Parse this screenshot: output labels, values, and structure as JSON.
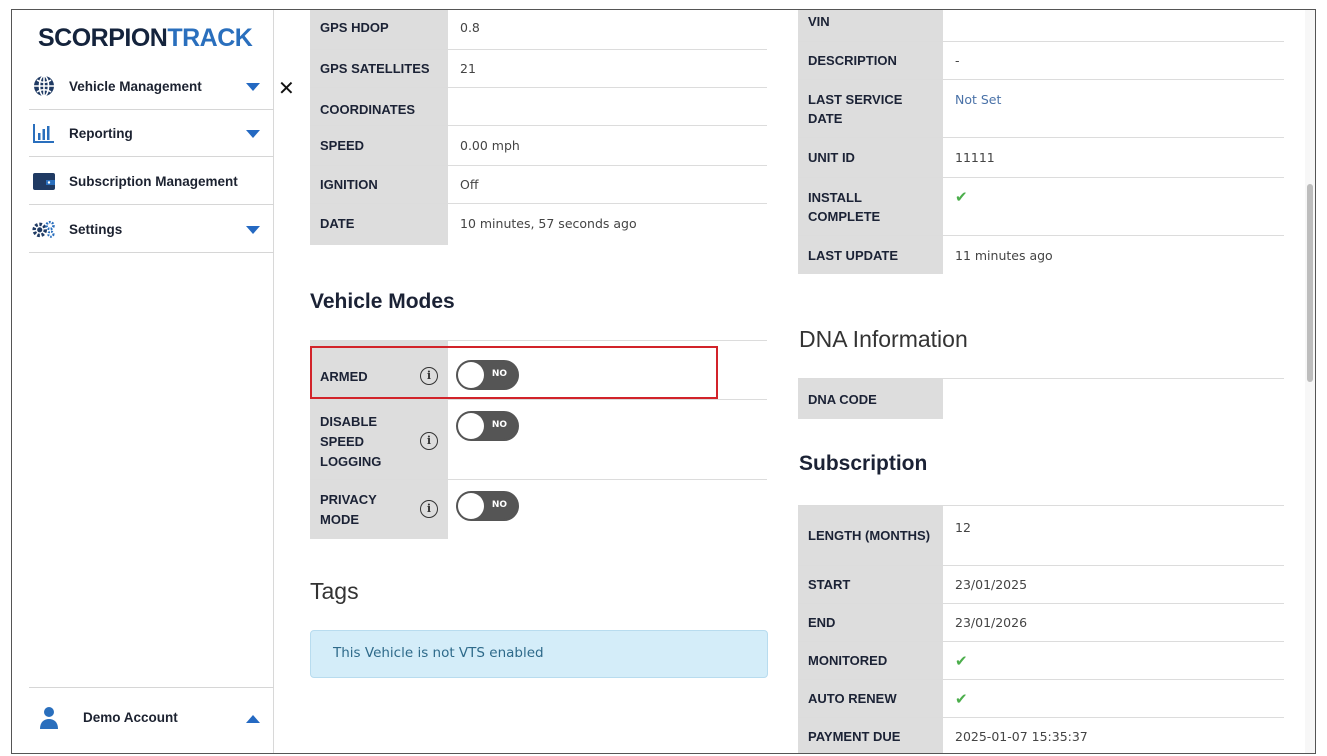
{
  "logo": {
    "part1": "SCORPION",
    "part2": "TRACK"
  },
  "sidebar": {
    "items": [
      {
        "label": "Vehicle Management",
        "icon": "globe-icon",
        "caret": "down"
      },
      {
        "label": "Reporting",
        "icon": "bar-chart-icon",
        "caret": "down"
      },
      {
        "label": "Subscription Management",
        "icon": "wallet-icon"
      },
      {
        "label": "Settings",
        "icon": "gears-icon",
        "caret": "down"
      }
    ],
    "account_label": "Demo Account"
  },
  "close_label": "✕",
  "gps": {
    "rows": [
      {
        "key": "GPS HDOP",
        "value": "0.8"
      },
      {
        "key": "GPS SATELLITES",
        "value": "21"
      },
      {
        "key": "COORDINATES",
        "value": ""
      },
      {
        "key": "SPEED",
        "value": "0.00 mph"
      },
      {
        "key": "IGNITION",
        "value": "Off"
      },
      {
        "key": "DATE",
        "value": "10 minutes, 57 seconds ago"
      }
    ]
  },
  "modes": {
    "title": "Vehicle Modes",
    "rows": [
      {
        "label": "ARMED",
        "state": "NO"
      },
      {
        "label": "DISABLE SPEED LOGGING",
        "state": "NO"
      },
      {
        "label": "PRIVACY MODE",
        "state": "NO"
      }
    ]
  },
  "tags": {
    "title": "Tags",
    "alert": "This Vehicle is not VTS enabled"
  },
  "vehicle_info": {
    "rows": [
      {
        "key": "VIN",
        "value": ""
      },
      {
        "key": "DESCRIPTION",
        "value": "-"
      },
      {
        "key": "LAST SERVICE DATE",
        "value": "Not Set"
      },
      {
        "key": "UNIT ID",
        "value": "11111"
      },
      {
        "key": "INSTALL COMPLETE",
        "value": "✔"
      },
      {
        "key": "LAST UPDATE",
        "value": "11 minutes ago"
      }
    ]
  },
  "dna": {
    "title": "DNA Information",
    "rows": [
      {
        "key": "DNA CODE",
        "value": ""
      }
    ]
  },
  "subscription": {
    "title": "Subscription",
    "rows": [
      {
        "key": "LENGTH (MONTHS)",
        "value": "12"
      },
      {
        "key": "START",
        "value": "23/01/2025"
      },
      {
        "key": "END",
        "value": "23/01/2026"
      },
      {
        "key": "MONITORED",
        "value": "✔"
      },
      {
        "key": "AUTO RENEW",
        "value": "✔"
      },
      {
        "key": "PAYMENT DUE",
        "value": "2025-01-07 15:35:37"
      }
    ]
  },
  "colors": {
    "brand_dark": "#14233c",
    "brand_blue": "#2a6fbd",
    "highlight": "#d2232a",
    "check": "#4cae4c"
  }
}
